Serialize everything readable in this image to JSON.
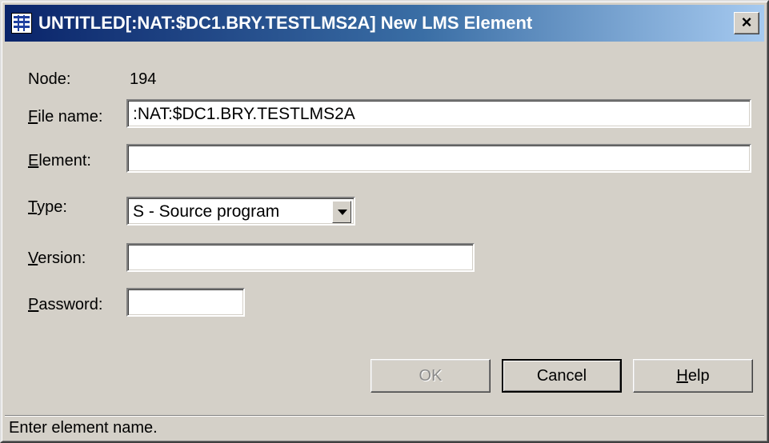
{
  "window": {
    "title": "UNTITLED[:NAT:$DC1.BRY.TESTLMS2A] New LMS Element",
    "close_label": "×"
  },
  "form": {
    "node_label": "Node:",
    "node_value": "194",
    "file_name_label_rest": "ile name:",
    "file_name_label_accel": "F",
    "file_name_value": ":NAT:$DC1.BRY.TESTLMS2A",
    "element_label_accel": "E",
    "element_label_rest": "lement:",
    "element_value": "",
    "type_label_accel": "T",
    "type_label_rest": "ype:",
    "type_value": "S - Source program",
    "version_label_accel": "V",
    "version_label_rest": "ersion:",
    "version_value": "",
    "password_label_accel": "P",
    "password_label_rest": "assword:",
    "password_value": ""
  },
  "buttons": {
    "ok_label": "OK",
    "cancel_label": "Cancel",
    "help_accel": "H",
    "help_rest": "elp"
  },
  "status_text": "Enter element name."
}
